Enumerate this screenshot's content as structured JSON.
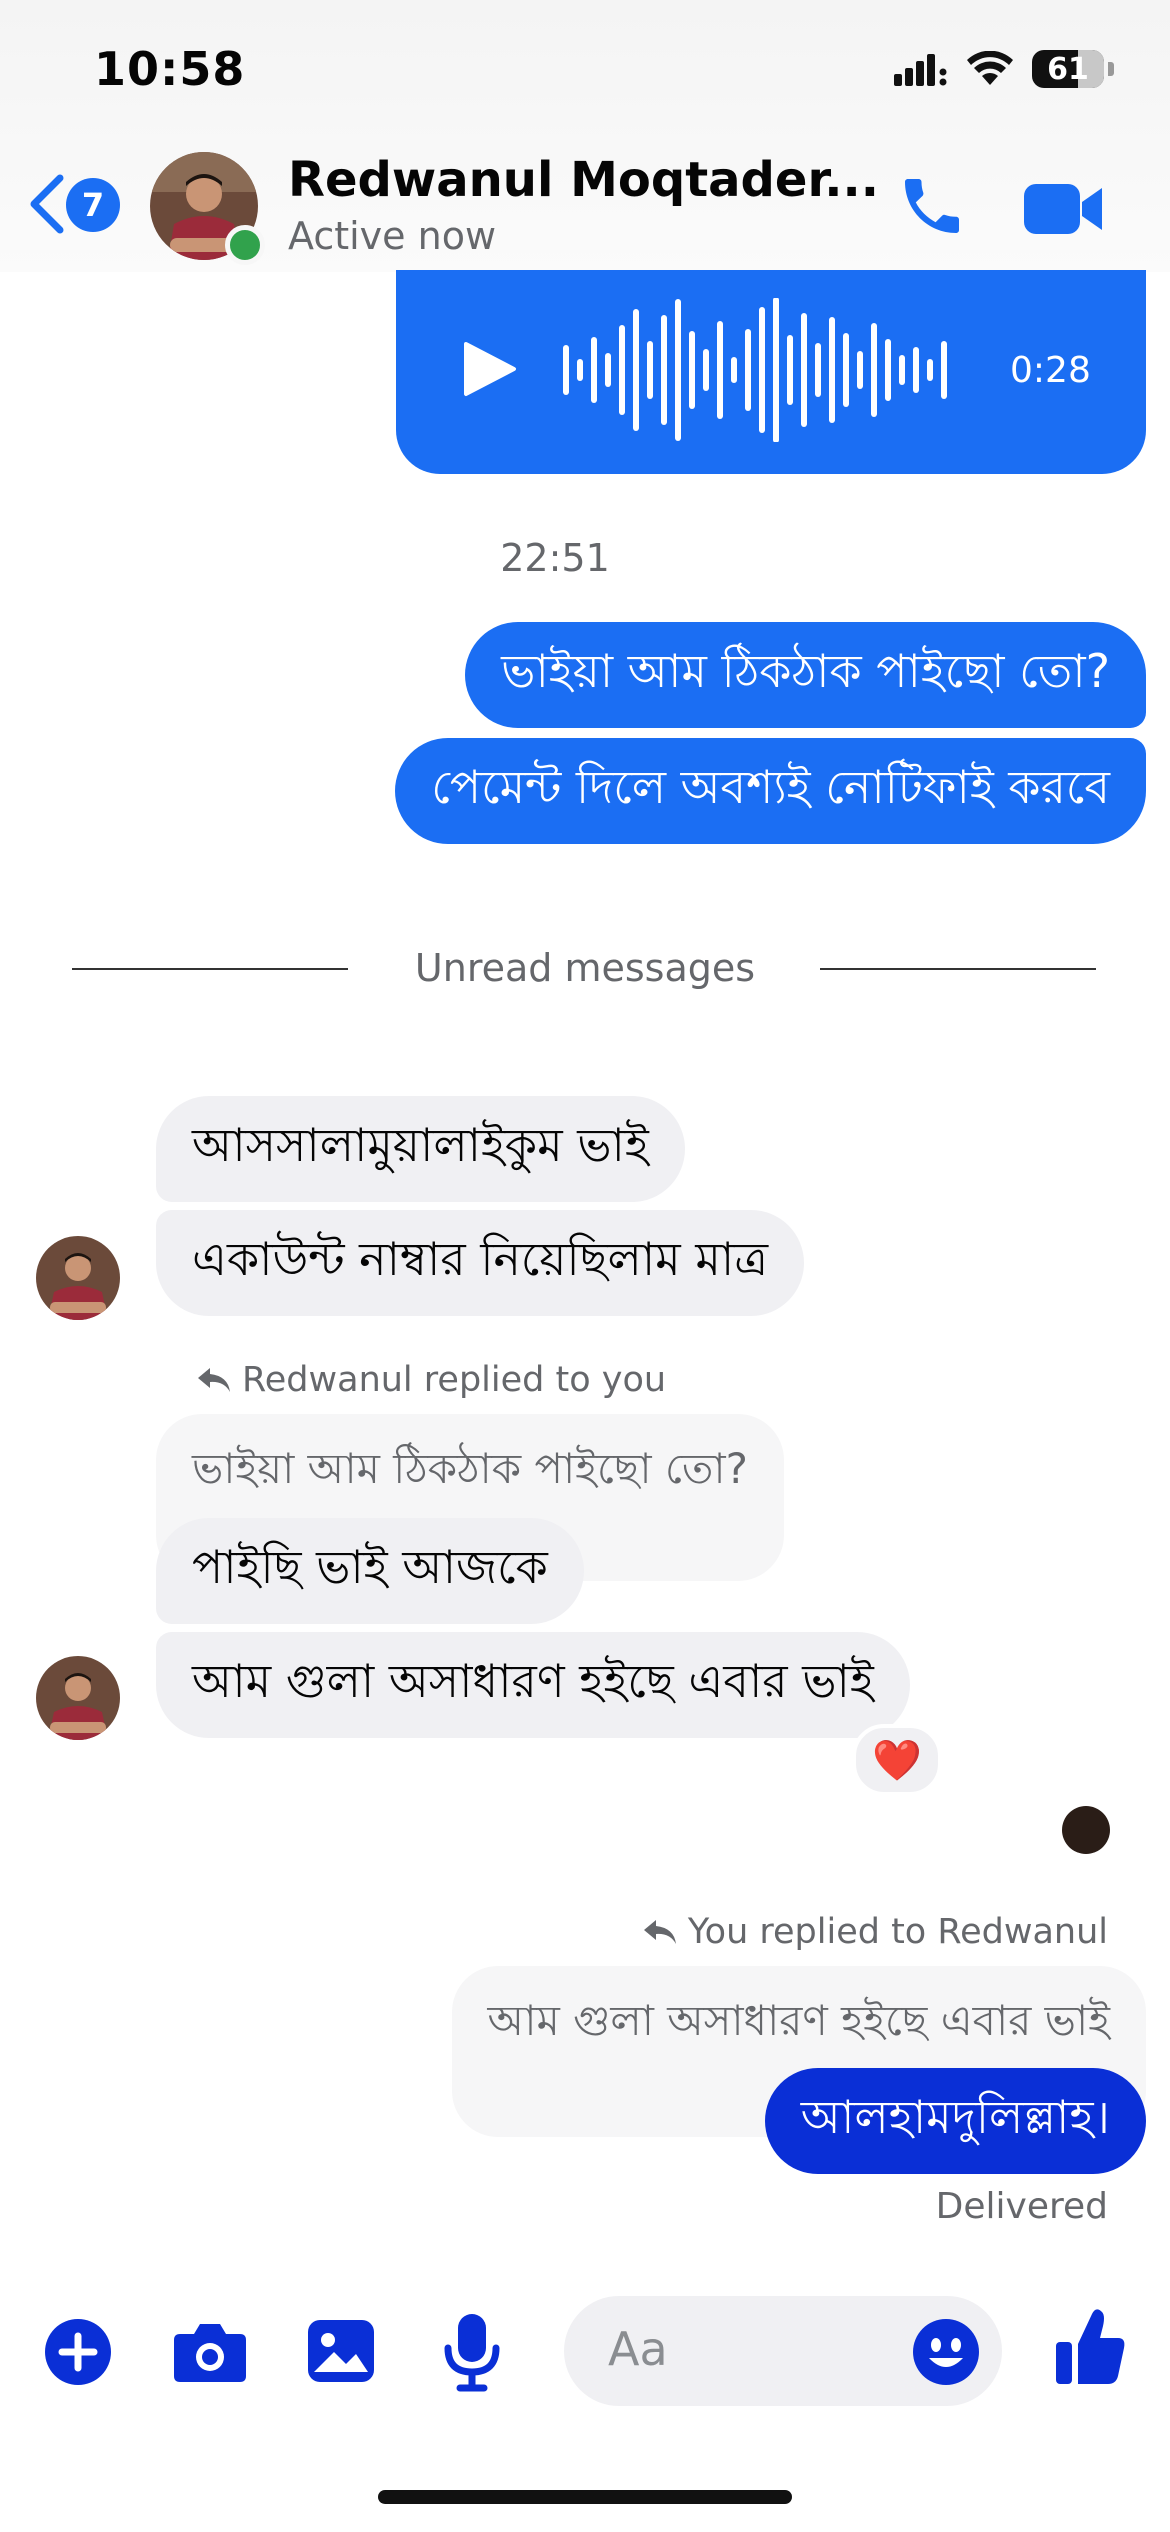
{
  "status_bar": {
    "time": "10:58",
    "battery": "61"
  },
  "header": {
    "unread_badge": "7",
    "contact_name": "Redwanul Moqtader...",
    "presence": "Active now"
  },
  "voice_message": {
    "duration": "0:28"
  },
  "timestamp": "22:51",
  "sent_block_1": [
    "ভাইয়া আম ঠিকঠাক পাইছো তো?",
    "পেমেন্ট দিলে অবশ্যই নোটিফাই করবে"
  ],
  "unread_divider": "Unread messages",
  "received_block_1": [
    "আসসালামুয়ালাইকুম ভাই",
    "একাউন্ট নাম্বার নিয়েছিলাম মাত্র"
  ],
  "reply_1": {
    "note": "Redwanul replied to you",
    "quoted": "ভাইয়া আম ঠিকঠাক পাইছো তো?"
  },
  "received_block_2": [
    "পাইছি ভাই আজকে",
    "আম গুলা অসাধারণ হইছে এবার ভাই"
  ],
  "reaction": "❤️",
  "reply_2": {
    "note": "You replied to Redwanul",
    "quoted": "আম গুলা অসাধারণ হইছে এবার ভাই"
  },
  "sent_reply": "আলহামদুলিল্লাহ।",
  "delivery_status": "Delivered",
  "composer": {
    "placeholder": "Aa"
  },
  "colors": {
    "accent": "#1b6ef3",
    "sent_reply_bubble": "#0a2fd6",
    "composer_icons": "#0a2fd6",
    "online": "#31a24c"
  },
  "icons": [
    "back-chevron-icon",
    "phone-icon",
    "video-camera-icon",
    "play-icon",
    "waveform-icon",
    "reply-arrow-icon",
    "plus-icon",
    "camera-icon",
    "image-icon",
    "microphone-icon",
    "emoji-icon",
    "thumbs-up-icon"
  ]
}
